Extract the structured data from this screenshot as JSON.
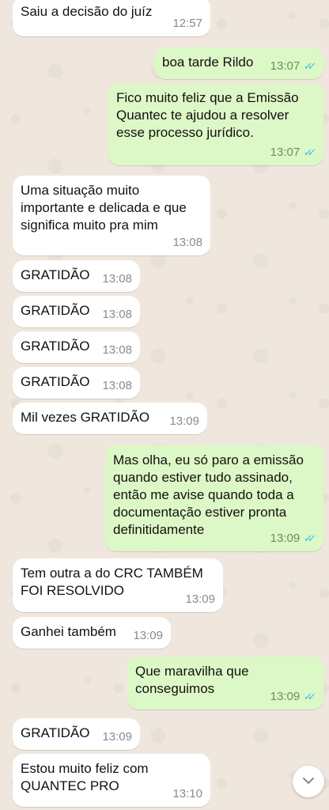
{
  "messages": [
    {
      "dir": "in",
      "text": "Saiu a decisão do juíz",
      "time": "12:57",
      "read": false
    },
    {
      "dir": "out",
      "text": "boa tarde Rildo",
      "time": "13:07",
      "read": true
    },
    {
      "dir": "out",
      "text": "Fico muito feliz que a Emissão\nQuantec te ajudou a resolver\nesse processo jurídico.",
      "time": "13:07",
      "read": true
    },
    {
      "dir": "in",
      "text": "Uma situação muito\nimportante e delicada e que\nsignifica muito pra mim",
      "time": "13:08",
      "read": false
    },
    {
      "dir": "in",
      "text": "GRATIDÃO",
      "time": "13:08",
      "read": false
    },
    {
      "dir": "in",
      "text": "GRATIDÃO",
      "time": "13:08",
      "read": false
    },
    {
      "dir": "in",
      "text": "GRATIDÃO",
      "time": "13:08",
      "read": false
    },
    {
      "dir": "in",
      "text": "GRATIDÃO",
      "time": "13:08",
      "read": false
    },
    {
      "dir": "in",
      "text": "Mil vezes GRATIDÃO",
      "time": "13:09",
      "read": false
    },
    {
      "dir": "out",
      "text": "Mas olha, eu só paro a emissão\nquando estiver tudo assinado,\nentão me avise quando toda a\ndocumentação estiver pronta\ndefinitidamente",
      "time": "13:09",
      "read": true
    },
    {
      "dir": "in",
      "text": "Tem outra a do CRC TAMBÉM\nFOI RESOLVIDO",
      "time": "13:09",
      "read": false
    },
    {
      "dir": "in",
      "text": "Ganhei também",
      "time": "13:09",
      "read": false
    },
    {
      "dir": "out",
      "text": "Que maravilha que\nconseguimos",
      "time": "13:09",
      "read": true
    },
    {
      "dir": "in",
      "text": "GRATIDÃO",
      "time": "13:09",
      "read": false
    },
    {
      "dir": "in",
      "text": "Estou muito feliz com\nQUANTEC PRO",
      "time": "13:10",
      "read": false
    }
  ],
  "icons": {
    "read_receipt": "double-check-icon",
    "scroll_down": "chevron-down-icon"
  },
  "colors": {
    "incoming_bubble": "#ffffff",
    "outgoing_bubble": "#dcf8c6",
    "read_tick": "#34b7f1",
    "wallpaper": "#efe7de"
  }
}
